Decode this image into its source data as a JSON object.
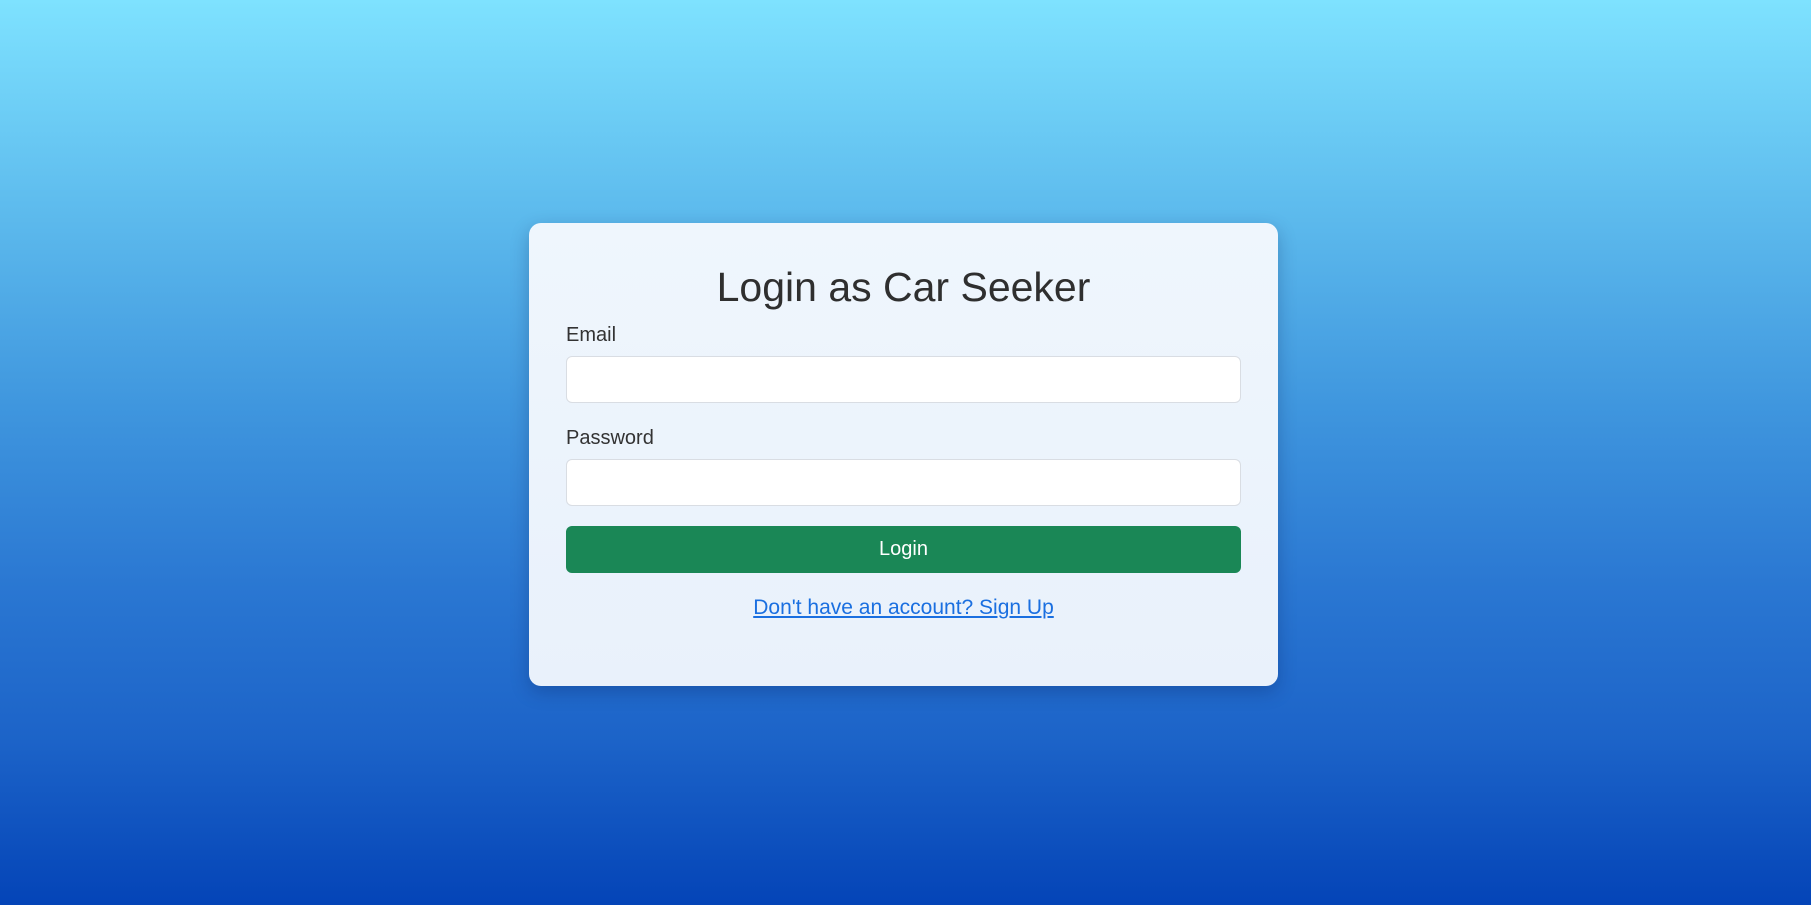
{
  "login_card": {
    "title": "Login as Car Seeker",
    "email": {
      "label": "Email",
      "value": "",
      "placeholder": ""
    },
    "password": {
      "label": "Password",
      "value": "",
      "placeholder": ""
    },
    "submit_label": "Login",
    "signup_link_text": "Don't have an account? Sign Up"
  },
  "colors": {
    "background_top": "#7ee2ff",
    "background_bottom": "#0444b7",
    "card_background": "#eef5fc",
    "primary_button": "#1a8756",
    "link": "#1a6fe0",
    "title_text": "#2f2f2f"
  }
}
